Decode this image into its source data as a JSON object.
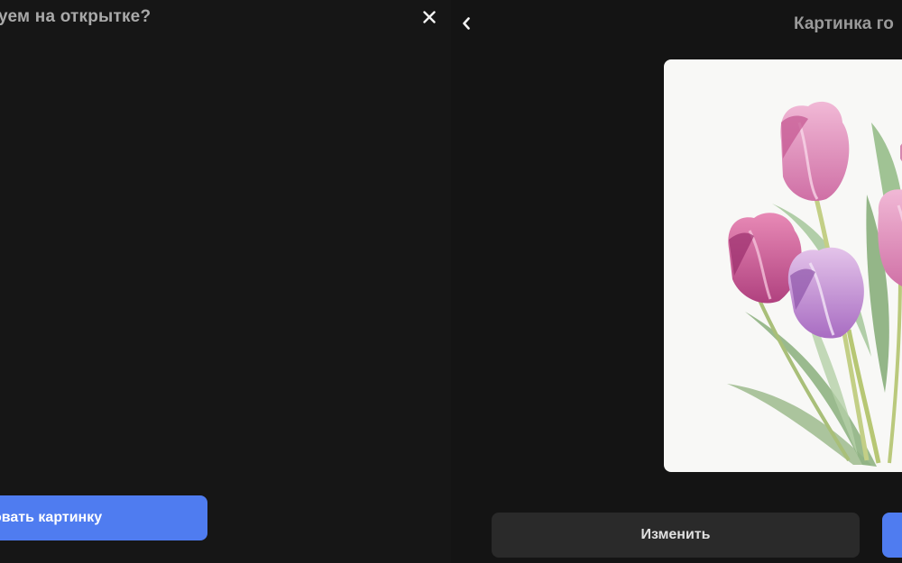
{
  "left_panel": {
    "title": "уем на открытке?",
    "close_icon": "close-icon",
    "primary_button_label": "овать картинку"
  },
  "right_panel": {
    "back_icon": "chevron-left-icon",
    "title": "Картинка го",
    "image": "tulips-watercolor-illustration",
    "edit_button_label": "Изменить"
  },
  "colors": {
    "background": "#141414",
    "accent": "#4f7cf0",
    "secondary_button": "#2a2a2a",
    "card": "#f8f8f6"
  }
}
